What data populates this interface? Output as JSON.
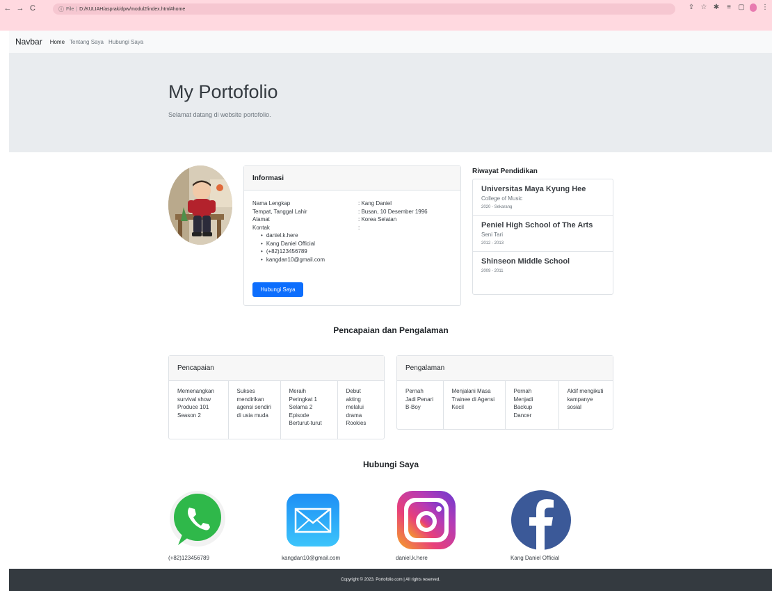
{
  "browser": {
    "url_prefix": "File",
    "url": "D:/KULIAH/asprak/dpw/modul2/index.html#home"
  },
  "navbar": {
    "brand": "Navbar",
    "links": [
      "Home",
      "Tentang Saya",
      "Hubungi Saya"
    ]
  },
  "hero": {
    "title": "My Portofolio",
    "subtitle": "Selamat datang di website portofolio."
  },
  "info": {
    "header": "Informasi",
    "rows": [
      {
        "key": "Nama Lengkap",
        "value": ": Kang Daniel"
      },
      {
        "key": "Tempat, Tanggal Lahir",
        "value": ": Busan, 10 Desember 1996"
      },
      {
        "key": "Alamat",
        "value": ": Korea Selatan"
      },
      {
        "key": "Kontak",
        "value": ":"
      }
    ],
    "contacts": [
      "daniel.k.here",
      "Kang Daniel Official",
      "(+82)123456789",
      "kangdan10@gmail.com"
    ],
    "button": "Hubungi Saya"
  },
  "education": {
    "title": "Riwayat Pendidikan",
    "items": [
      {
        "school": "Universitas Maya Kyung Hee",
        "major": "College of Music",
        "years": "2020 - Sekarang"
      },
      {
        "school": "Peniel High School of The Arts",
        "major": "Seni Tari",
        "years": "2012 - 2013"
      },
      {
        "school": "Shinseon Middle School",
        "major": "",
        "years": "2009 - 2011"
      }
    ]
  },
  "achievements_section": {
    "title": "Pencapaian dan Pengalaman",
    "achievements": {
      "header": "Pencapaian",
      "items": [
        "Memenangkan survival show Produce 101 Season 2",
        "Sukses mendirikan agensi sendiri di usia muda",
        "Meraih Peringkat 1 Selama 2 Episode Berturut-turut",
        "Debut akting melalui drama Rookies"
      ]
    },
    "experience": {
      "header": "Pengalaman",
      "items": [
        "Pernah Jadi Penari B-Boy",
        "Menjalani Masa Trainee di Agensi Kecil",
        "Pernah Menjadi Backup Dancer",
        "Aktif mengikuti kampanye sosial"
      ]
    }
  },
  "contact_section": {
    "title": "Hubungi Saya",
    "items": [
      {
        "icon": "whatsapp-icon",
        "label": "(+82)123456789"
      },
      {
        "icon": "mail-icon",
        "label": "kangdan10@gmail.com"
      },
      {
        "icon": "instagram-icon",
        "label": "daniel.k.here"
      },
      {
        "icon": "facebook-icon",
        "label": "Kang Daniel Official"
      }
    ]
  },
  "footer": {
    "text": "Copyright © 2023. Portofolio.com | All rights reserved."
  },
  "colors": {
    "primary": "#0d6efd",
    "footer_bg": "#343a40",
    "jumbotron_bg": "#e9ecef",
    "browser_chrome": "#ffd9e0"
  }
}
